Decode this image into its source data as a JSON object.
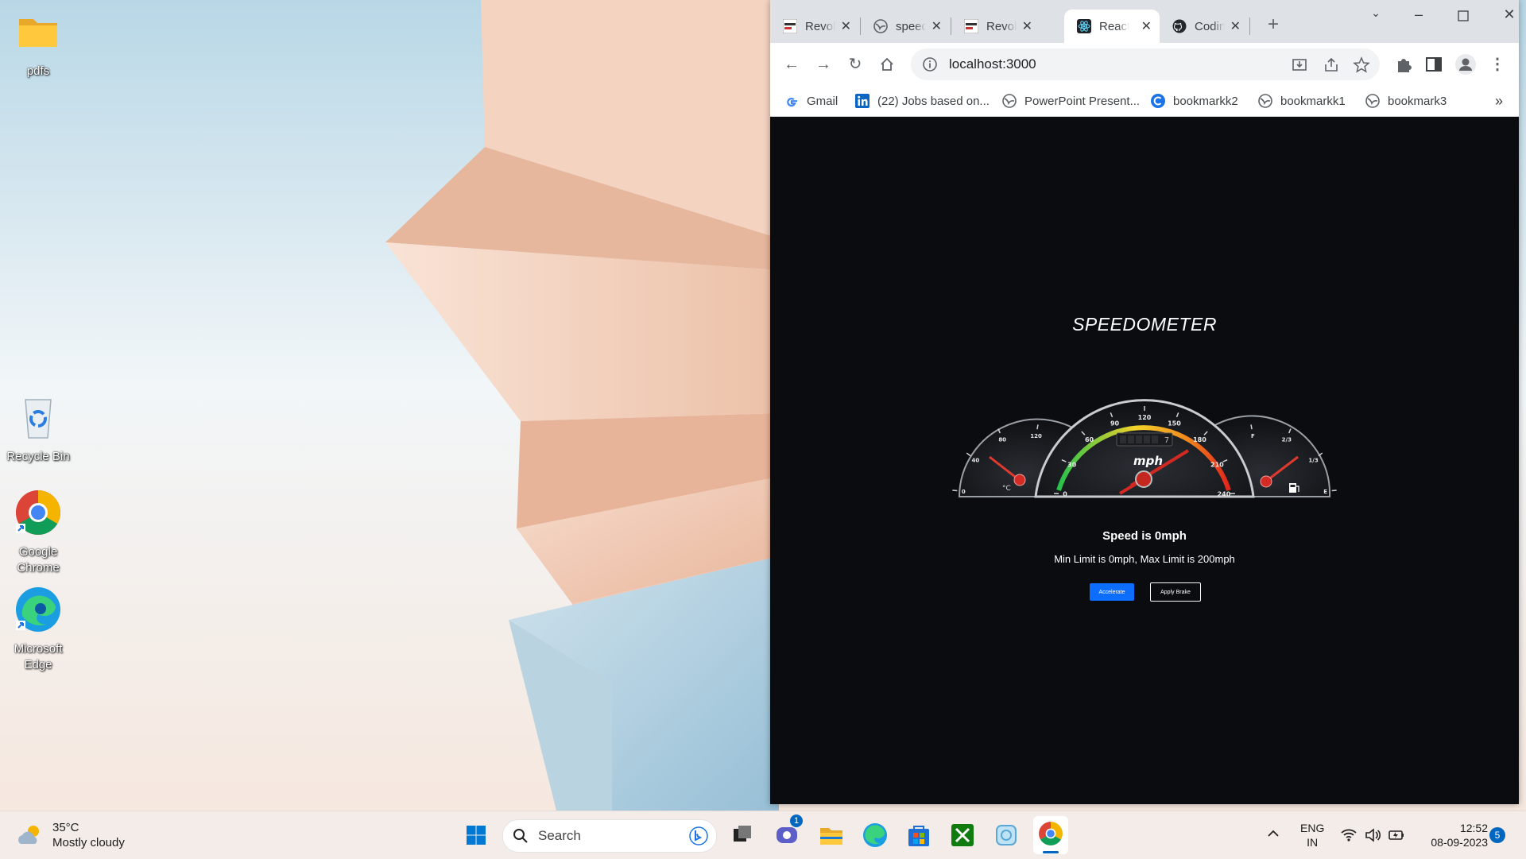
{
  "desktop": {
    "icons": [
      {
        "label": "pdfs",
        "icon": "folder-icon"
      },
      {
        "label": "Recycle Bin",
        "icon": "recycle-bin-icon"
      },
      {
        "label": "Google Chrome",
        "icon": "chrome-icon"
      },
      {
        "label": "Microsoft Edge",
        "icon": "edge-icon"
      }
    ]
  },
  "browser": {
    "tabs": [
      {
        "title": "Revolu",
        "icon": "novo-icon",
        "active": false
      },
      {
        "title": "speed",
        "icon": "globe-icon",
        "active": false
      },
      {
        "title": "Revolu",
        "icon": "novo-icon",
        "active": false
      },
      {
        "title": "React",
        "icon": "react-icon",
        "active": true
      },
      {
        "title": "Codin",
        "icon": "github-icon",
        "active": false
      }
    ],
    "address": "localhost:3000",
    "bookmarks": [
      {
        "label": "Gmail",
        "icon": "google-icon"
      },
      {
        "label": "(22) Jobs based on...",
        "icon": "linkedin-icon"
      },
      {
        "label": "PowerPoint Present...",
        "icon": "globe-icon"
      },
      {
        "label": "bookmarkk2",
        "icon": "c-icon"
      },
      {
        "label": "bookmarkk1",
        "icon": "globe-icon"
      },
      {
        "label": "bookmark3",
        "icon": "globe-icon"
      }
    ],
    "overflow": "»"
  },
  "page": {
    "title": "SPEEDOMETER",
    "speed_text": "Speed is 0mph",
    "limit_text": "Min Limit is 0mph, Max Limit is 200mph",
    "accelerate_label": "Accelerate",
    "brake_label": "Apply Brake",
    "gauge": {
      "unit": "mph",
      "speed_ticks": [
        "0",
        "30",
        "60",
        "90",
        "120",
        "150",
        "180",
        "210",
        "240"
      ],
      "temp_ticks": [
        "0",
        "40",
        "80",
        "120"
      ],
      "temp_unit": "°C",
      "fuel_ticks": [
        "E",
        "1/3",
        "2/3",
        "F"
      ],
      "odometer": "7"
    },
    "colors": {
      "background": "#0b0c10",
      "accent": "#0d6efd"
    }
  },
  "taskbar": {
    "weather_temp": "35°C",
    "weather_desc": "Mostly cloudy",
    "search_placeholder": "Search",
    "chat_badge": "1",
    "lang_line1": "ENG",
    "lang_line2": "IN",
    "time": "12:52",
    "date": "08-09-2023",
    "notification_count": "5"
  }
}
